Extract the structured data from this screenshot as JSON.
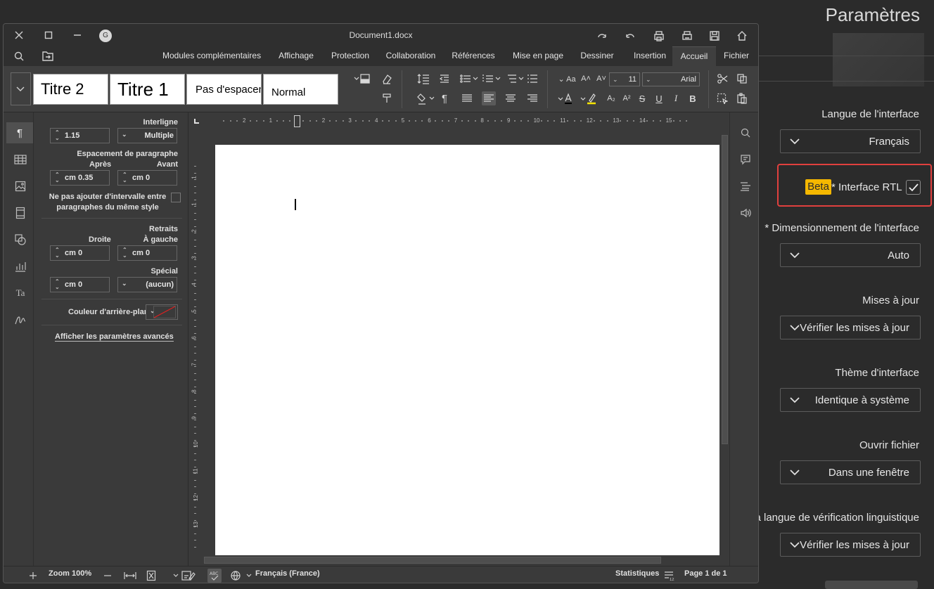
{
  "settings": {
    "title": "Paramètres",
    "language_label": "Langue de l'interface",
    "language_value": "Français",
    "beta_badge": "Beta",
    "rtl_label": "* Interface RTL",
    "rtl_checked": true,
    "scaling_label": "* Dimensionnement de l'interface",
    "scaling_value": "Auto",
    "updates_label": "Mises à jour",
    "updates_value": "Vérifier les mises à jour",
    "theme_label": "Thème d'interface",
    "theme_value": "Identique à système",
    "open_file_label": "Ouvrir fichier",
    "open_file_value": "Dans une fenêtre",
    "spellcheck_label": "La langue de vérification linguistique",
    "spellcheck_value": "Vérifier les mises à jour",
    "accent_color": "#f5b800",
    "highlight_color": "#e0403e"
  },
  "window": {
    "title": "Document1.docx",
    "avatar_initial": "G",
    "tabs": [
      "Modules complémentaires",
      "Affichage",
      "Protection",
      "Collaboration",
      "Références",
      "Mise en page",
      "Dessiner",
      "Insertion",
      "Accueil",
      "Fichier"
    ],
    "active_tab": "Accueil"
  },
  "ribbon": {
    "styles": [
      "Titre 2",
      "Titre 1",
      "Pas d'espacement",
      "Normal"
    ],
    "font_size": "11",
    "font_name": "Arial"
  },
  "paragraph_panel": {
    "line_spacing_label": "Interligne",
    "line_spacing_value": "1.15",
    "line_spacing_mode": "Multiple",
    "para_spacing_label": "Espacement de paragraphe",
    "after_label": "Après",
    "before_label": "Avant",
    "after_value": "cm 0.35",
    "before_value": "cm 0",
    "no_interval_text": "Ne pas ajouter d'intervalle entre paragraphes du même style",
    "indents_label": "Retraits",
    "right_label": "Droite",
    "left_label": "À gauche",
    "right_value": "cm 0",
    "left_value": "cm 0",
    "special_label": "Spécial",
    "special_value": "cm 0",
    "special_mode": "(aucun)",
    "bg_color_label": "Couleur d'arrière-plan",
    "advanced_link": "Afficher les paramètres avancés"
  },
  "rulers": {
    "horizontal": [
      "2",
      "1",
      "1",
      "2",
      "3",
      "4",
      "5",
      "6",
      "7",
      "8",
      "9",
      "10",
      "11",
      "12",
      "13",
      "14",
      "15"
    ],
    "vertical": [
      "1",
      "1",
      "2",
      "3",
      "4",
      "5",
      "6",
      "7",
      "8",
      "9",
      "10",
      "11",
      "12",
      "13"
    ]
  },
  "statusbar": {
    "zoom": "Zoom 100%",
    "language": "Français (France)",
    "statistics": "Statistiques",
    "page_info": "Page 1 de 1"
  }
}
